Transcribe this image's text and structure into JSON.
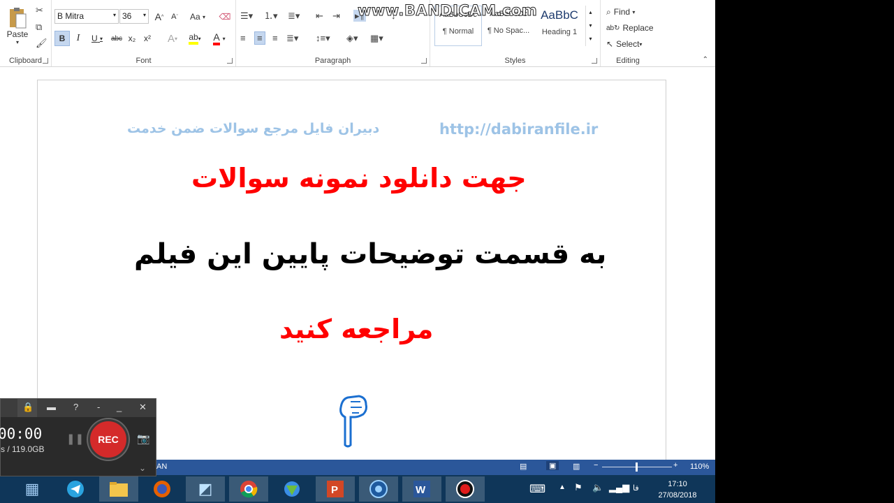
{
  "ribbon": {
    "clipboard": {
      "paste": "Paste",
      "label": "Clipboard"
    },
    "font": {
      "name": "B Mitra",
      "size": "36",
      "label": "Font",
      "grow": "A",
      "shrink": "A",
      "case": "Aa",
      "bold": "B",
      "italic": "I",
      "underline": "U",
      "strike": "abc",
      "sub": "x₂",
      "sup": "x²",
      "effects": "A",
      "color": "A"
    },
    "paragraph": {
      "label": "Paragraph"
    },
    "styles": {
      "label": "Styles",
      "items": [
        {
          "preview": "AaBbCcDc",
          "name": "¶ Normal"
        },
        {
          "preview": "AaBbCcDc",
          "name": "¶ No Spac..."
        },
        {
          "preview": "AaBbC",
          "name": "Heading 1"
        }
      ]
    },
    "editing": {
      "label": "Editing",
      "find": "Find",
      "replace": "Replace",
      "select": "Select"
    }
  },
  "document": {
    "header_left": "دبیران فایل مرجع سوالات ضمن خدمت",
    "header_right": "http://dabiranfile.ir",
    "line1": "جهت دانلود نمونه سوالات",
    "line2": "به قسمت توضیحات پایین این فیلم",
    "line3": "مراجعه کنید"
  },
  "watermark": "www.BANDICAM.com",
  "recorder": {
    "timer": "00:00",
    "size": "s / 119.0GB",
    "rec": "REC"
  },
  "statusbar": {
    "lang": "AN",
    "zoom": "110%"
  },
  "taskbar": {
    "time": "17:10",
    "date": "27/08/2018",
    "lang": "فا"
  },
  "colors": {
    "red": "#ff0000",
    "link": "#9dc3e6",
    "statusbar": "#2b579a",
    "taskbar": "#0f3659"
  }
}
